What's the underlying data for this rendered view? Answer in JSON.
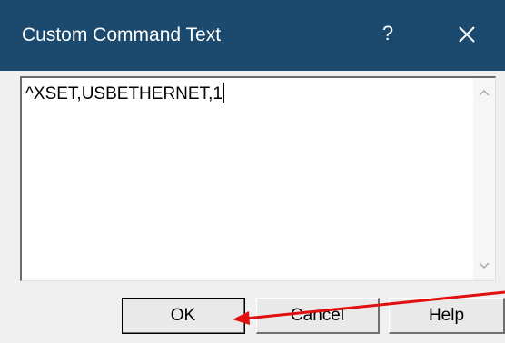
{
  "window": {
    "title": "Custom Command Text",
    "help_glyph": "?"
  },
  "editor": {
    "value": "^XSET,USBETHERNET,1"
  },
  "buttons": {
    "ok": "OK",
    "cancel": "Cancel",
    "help": "Help"
  },
  "colors": {
    "titlebar": "#1b4a6e",
    "annotation_arrow": "#e01010"
  },
  "icons": {
    "close": "close-icon",
    "help": "help-icon",
    "scroll_up": "chevron-up-icon",
    "scroll_down": "chevron-down-icon",
    "annotation": "arrow-annotation"
  }
}
